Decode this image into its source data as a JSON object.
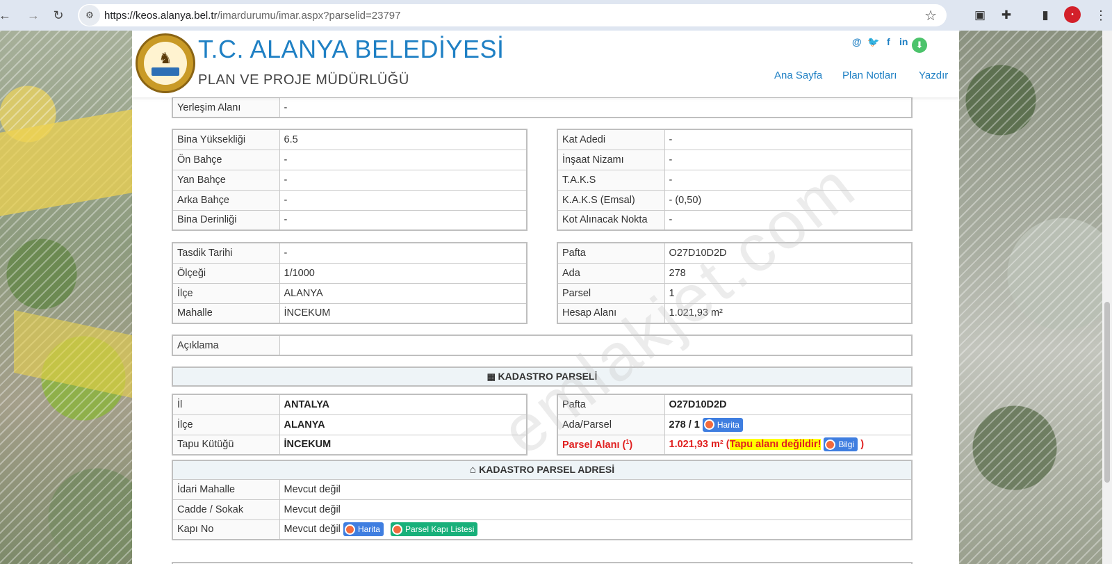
{
  "browser": {
    "url_host": "https://keos.alanya.bel.tr",
    "url_path": "/imardurumu/imar.aspx?parselid=23797"
  },
  "header": {
    "title": "T.C. ALANYA BELEDİYESİ",
    "subtitle": "PLAN VE PROJE MÜDÜRLÜĞÜ",
    "logo_text": "ALANYA BELEDİYESİ",
    "nav": {
      "home": "Ana Sayfa",
      "notes": "Plan Notları",
      "print": "Yazdır"
    }
  },
  "yerlesim": {
    "label": "Yerleşim Alanı",
    "value": "-"
  },
  "bina_left": [
    {
      "label": "Bina Yüksekliği",
      "value": "6.5"
    },
    {
      "label": "Ön Bahçe",
      "value": "-"
    },
    {
      "label": "Yan Bahçe",
      "value": "-"
    },
    {
      "label": "Arka Bahçe",
      "value": "-"
    },
    {
      "label": "Bina Derinliği",
      "value": "-"
    }
  ],
  "bina_right": [
    {
      "label": "Kat Adedi",
      "value": "-"
    },
    {
      "label": "İnşaat Nizamı",
      "value": "-"
    },
    {
      "label": "T.A.K.S",
      "value": "-"
    },
    {
      "label": "K.A.K.S (Emsal)",
      "value": "- (0,50)"
    },
    {
      "label": "Kot Alınacak Nokta",
      "value": "-"
    }
  ],
  "plan_left": [
    {
      "label": "Tasdik Tarihi",
      "value": "-"
    },
    {
      "label": "Ölçeği",
      "value": "1/1000"
    },
    {
      "label": "İlçe",
      "value": "ALANYA"
    },
    {
      "label": "Mahalle",
      "value": "İNCEKUM"
    }
  ],
  "plan_right": [
    {
      "label": "Pafta",
      "value": "O27D10D2D"
    },
    {
      "label": "Ada",
      "value": "278"
    },
    {
      "label": "Parsel",
      "value": "1"
    },
    {
      "label": "Hesap Alanı",
      "value": "1.021,93 m²"
    }
  ],
  "aciklama": {
    "label": "Açıklama",
    "value": ""
  },
  "kadastro": {
    "heading": "KADASTRO PARSELİ",
    "left": [
      {
        "label": "İl",
        "value": "ANTALYA"
      },
      {
        "label": "İlçe",
        "value": "ALANYA"
      },
      {
        "label": "Tapu Kütüğü",
        "value": "İNCEKUM"
      }
    ],
    "pafta_label": "Pafta",
    "pafta_value": "O27D10D2D",
    "ada_label": "Ada/Parsel",
    "ada_value": "278 / 1",
    "harita_label": "Harita",
    "parsel_alani_label": "Parsel Alanı (",
    "parsel_alani_sup": "1",
    "parsel_alani_close": ")",
    "parsel_alani_value": "1.021,93 m²",
    "paren_open": "(",
    "tapu_warning": "Tapu alanı değildir!",
    "bilgi_label": "Bilgi",
    "paren_close": ")"
  },
  "adres": {
    "heading": "KADASTRO PARSEL ADRESİ",
    "rows": [
      {
        "label": "İdari Mahalle",
        "value": "Mevcut değil"
      },
      {
        "label": "Cadde / Sokak",
        "value": "Mevcut değil"
      },
      {
        "label": "Kapı No",
        "value": "Mevcut değil"
      }
    ],
    "harita_label": "Harita",
    "kapi_listesi_label": "Parsel Kapı Listesi"
  },
  "watermark": "emlakjet.com",
  "colors": {
    "brand": "#1f80c4",
    "warning_red": "#e02020",
    "highlight": "#ffff00",
    "tag_blue": "#3f7ee0",
    "tag_green": "#18b07a"
  }
}
